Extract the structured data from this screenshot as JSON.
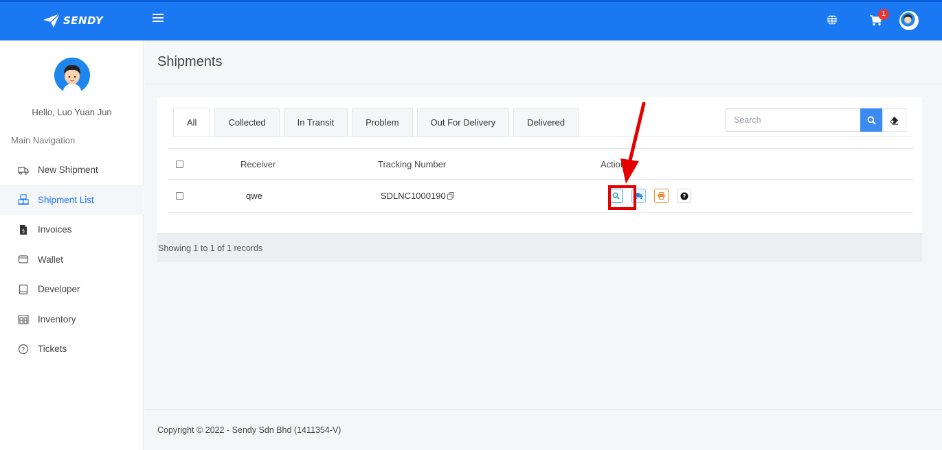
{
  "header": {
    "brand": "SENDY",
    "cart_count": "1",
    "icons": [
      "menu-icon",
      "globe-icon",
      "cart-icon",
      "avatar"
    ]
  },
  "sidebar": {
    "greeting": "Hello, Luo Yuan Jun",
    "caption": "Main Navigation",
    "items": [
      {
        "label": "New Shipment",
        "icon": "truck-icon"
      },
      {
        "label": "Shipment List",
        "icon": "boxes-icon"
      },
      {
        "label": "Invoices",
        "icon": "invoice-icon"
      },
      {
        "label": "Wallet",
        "icon": "wallet-icon"
      },
      {
        "label": "Developer",
        "icon": "book-icon"
      },
      {
        "label": "Inventory",
        "icon": "warehouse-icon"
      },
      {
        "label": "Tickets",
        "icon": "help-circle-icon"
      }
    ],
    "active_item": "Shipment List"
  },
  "main": {
    "title": "Shipments",
    "tabs": [
      "All",
      "Collected",
      "In Transit",
      "Problem",
      "Out For Delivery",
      "Delivered"
    ],
    "active_tab": "All",
    "search": {
      "placeholder": "Search",
      "value": ""
    },
    "table": {
      "columns": [
        "Receiver",
        "Tracking Number",
        "Action"
      ],
      "rows": [
        {
          "receiver": "qwe",
          "tracking": "SDLNC1000190"
        }
      ]
    },
    "records_text": "Showing 1 to 1 of 1 records",
    "copyright": "Copyright © 2022 - Sendy Sdn Bhd (1411354-V)"
  },
  "colors": {
    "brand": "#1a78f2",
    "highlight": "#e50000",
    "view_button": "#1fa3d6",
    "print_button": "#f08a36"
  }
}
